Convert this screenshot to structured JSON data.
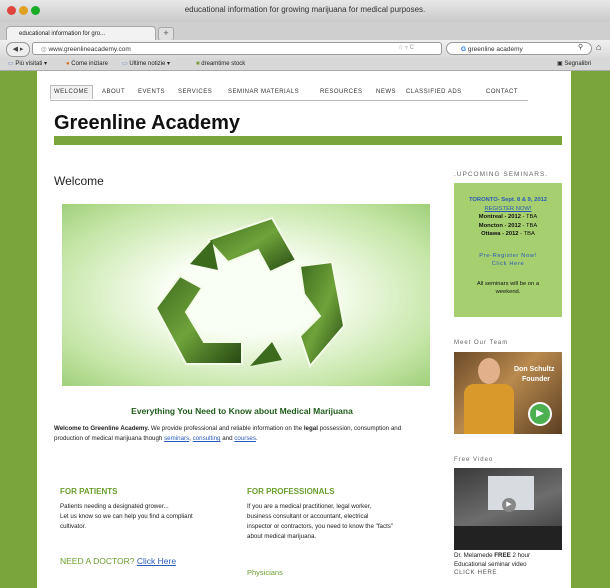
{
  "browser": {
    "window_title": "educational information for growing marijuana for medical purposes.",
    "tab_title": "educational information for gro...",
    "url": "www.greenlineacademy.com",
    "search_value": "greenline academy",
    "bookmarks": [
      "Più visitati",
      "Come iniziare",
      "Ultime notizie",
      "dreamtime stock"
    ],
    "bookmarks_right": "Segnalibri"
  },
  "nav": {
    "items": [
      "WELCOME",
      "ABOUT",
      "EVENTS",
      "SERVICES",
      "SEMINAR MATERIALS",
      "RESOURCES",
      "NEWS",
      "CLASSIFIED ADS",
      "CONTACT"
    ]
  },
  "site": {
    "title": "Greenline Academy"
  },
  "main": {
    "page_heading": "Welcome",
    "headline": "Everything You Need to Know about Medical Marijuana",
    "intro": {
      "lead": "Welcome to Greenline Academy.",
      "text1": " We provide professional and reliable information on the ",
      "legal": "legal",
      "text2": " possession, consumption and production of medical marijuana though ",
      "link1": "seminars",
      "sep": ", ",
      "link2": "consulting",
      "and": " and ",
      "link3": "courses",
      "end": "."
    },
    "patients": {
      "heading": "FOR PATIENTS",
      "line1": "Patients needing a designated grower...",
      "line2": "Let us know so we can help you find a compliant",
      "line3": "cultivator."
    },
    "professionals": {
      "heading": "FOR PROFESSIONALS",
      "line1": "If you are a medical practitioner, legal worker,",
      "line2": "business consultant or accountant, electrical",
      "line3": "inspector or contractors, you need to know the \"facts\"",
      "line4": "about medical marijuana."
    },
    "need_doctor": {
      "text": "NEED A DOCTOR? ",
      "link": "Click Here"
    },
    "physicians": "Physicians"
  },
  "sidebar": {
    "upcoming_heading": ".UPCOMING SEMINARS.",
    "toronto": "TORONTO- Sept. 8 & 9, 2012",
    "register": "REGISTER NOW!",
    "montreal": "Montreal - 2012",
    "moncton": "Moncton - 2012",
    "ottawa": "Ottawa - 2012",
    "tba": " - TBA",
    "pre_register": "Pre-Register Now!",
    "click_here": "Click Here",
    "weekend_note_1": "All seminars will be on a",
    "weekend_note_2": "weekend.",
    "team_heading": "Meet Our Team",
    "team_name": "Don Schultz",
    "team_role": "Founder",
    "video_heading": "Free Video",
    "video_caption_1": "Dr. Melamede",
    "video_free": "FREE",
    "video_caption_2": " 2 hour",
    "video_caption_3": "Educational seminar video",
    "video_click": "CLICK HERE"
  },
  "colors": {
    "brand_green": "#7aa53c",
    "link_blue": "#2a5bb8",
    "heading_green": "#6a9e2e"
  }
}
